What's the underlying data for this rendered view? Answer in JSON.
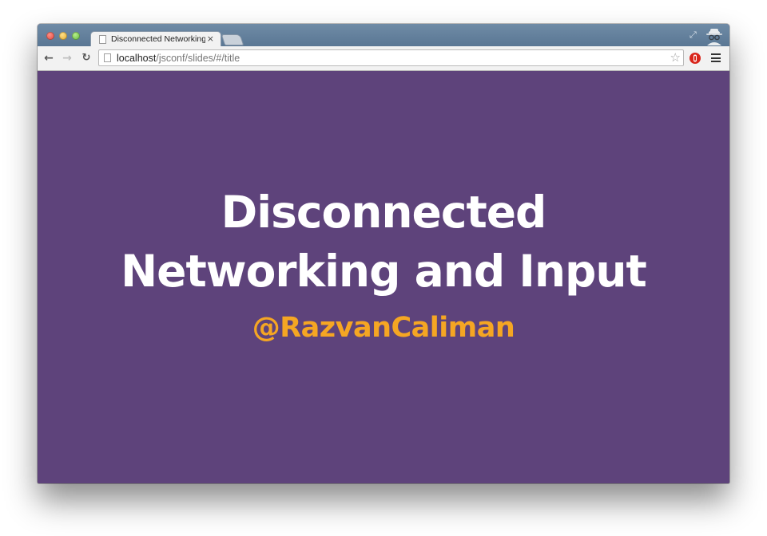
{
  "browser": {
    "tab": {
      "title": "Disconnected Networking",
      "close_glyph": "×"
    },
    "address_bar": {
      "host": "localhost",
      "path": "/jsconf/slides/#/title"
    },
    "icons": {
      "close": "traffic-light-close",
      "minimize": "traffic-light-minimize",
      "maximize": "traffic-light-maximize",
      "back": "←",
      "forward": "→",
      "reload": "↻",
      "bookmark": "☆",
      "fullscreen": "⤢",
      "incognito": "incognito-icon",
      "extension": "extension-icon",
      "menu": "hamburger-menu-icon"
    }
  },
  "slide": {
    "title_line1": "Disconnected",
    "title_line2": "Networking and Input",
    "subtitle": "@RazvanCaliman",
    "background_color": "#5e437b",
    "title_color": "#ffffff",
    "subtitle_color": "#f5a623"
  }
}
